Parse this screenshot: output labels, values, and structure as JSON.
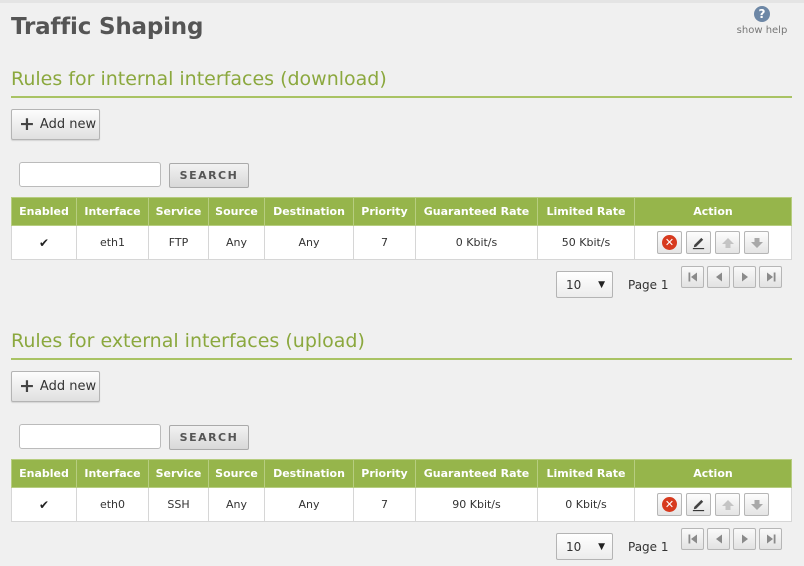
{
  "page": {
    "title": "Traffic Shaping",
    "help_label": "show help",
    "help_glyph": "?"
  },
  "colors": {
    "accent_green": "#96b54b",
    "section_title_green": "#8ba83e",
    "delete_red": "#d73a1e",
    "help_blue": "#6d87a6"
  },
  "columns": [
    "Enabled",
    "Interface",
    "Service",
    "Source",
    "Destination",
    "Priority",
    "Guaranteed Rate",
    "Limited Rate",
    "Action"
  ],
  "download": {
    "title": "Rules for internal interfaces (download)",
    "add_label": "Add new",
    "search_placeholder": "",
    "search_label": "SEARCH",
    "rows": [
      {
        "enabled": true,
        "check": "✔",
        "interface": "eth1",
        "service": "FTP",
        "source": "Any",
        "destination": "Any",
        "priority": "7",
        "guaranteed": "0 Kbit/s",
        "limited": "50 Kbit/s"
      }
    ],
    "page_size": "10",
    "page_label": "Page 1"
  },
  "upload": {
    "title": "Rules for external interfaces (upload)",
    "add_label": "Add new",
    "search_placeholder": "",
    "search_label": "SEARCH",
    "rows": [
      {
        "enabled": true,
        "check": "✔",
        "interface": "eth0",
        "service": "SSH",
        "source": "Any",
        "destination": "Any",
        "priority": "7",
        "guaranteed": "90 Kbit/s",
        "limited": "0 Kbit/s"
      }
    ],
    "page_size": "10",
    "page_label": "Page 1"
  },
  "icons": {
    "help": "help-icon",
    "add": "plus-icon",
    "delete": "delete-icon",
    "edit": "pencil-icon",
    "move_up": "arrow-up-icon",
    "move_down": "arrow-down-icon",
    "first": "first-page-icon",
    "prev": "previous-page-icon",
    "next": "next-page-icon",
    "last": "last-page-icon",
    "dropdown": "chevron-down-icon"
  }
}
